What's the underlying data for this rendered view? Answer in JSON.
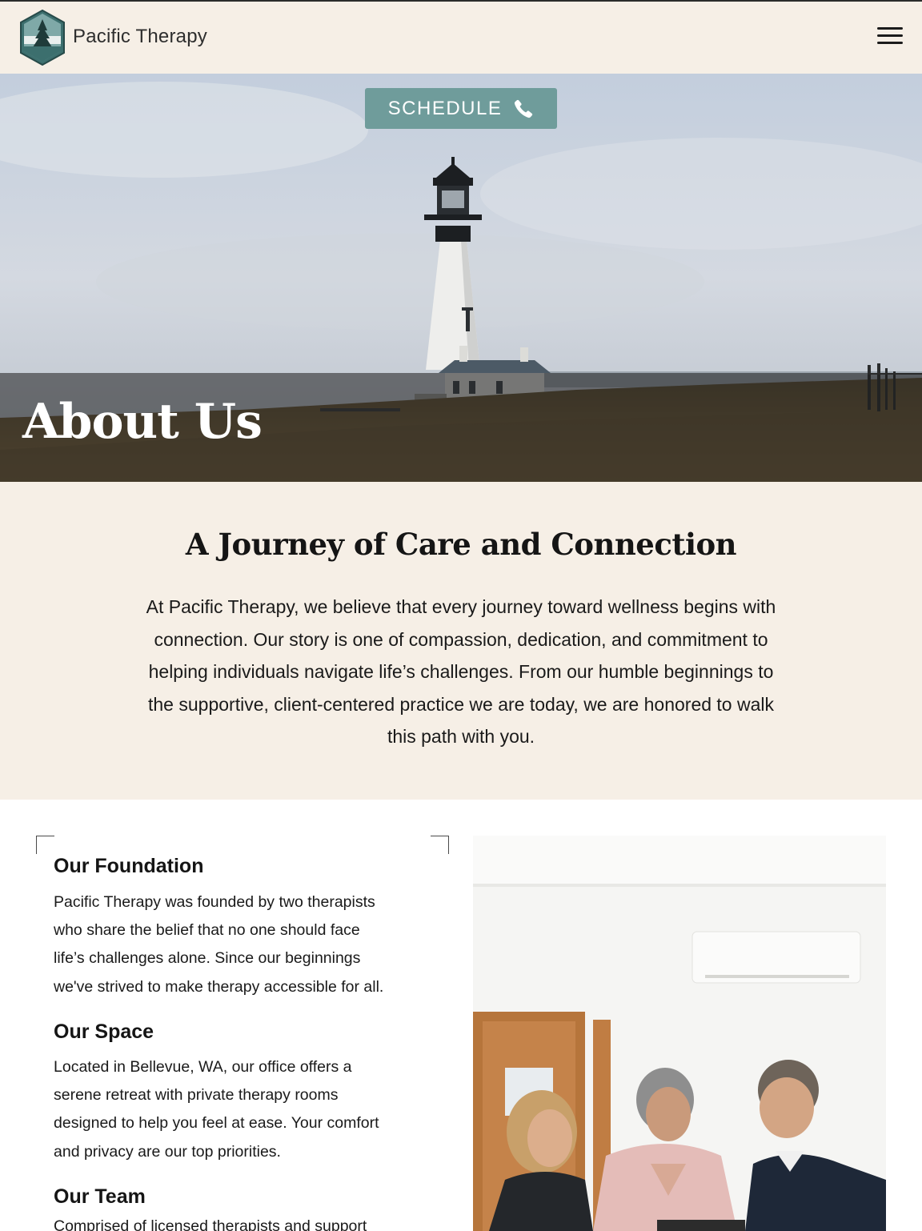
{
  "header": {
    "brand": "Pacific Therapy",
    "logo_icon": "pine-tree-hexagon-logo",
    "menu_icon": "hamburger-menu-icon"
  },
  "hero": {
    "schedule_label": "SCHEDULE",
    "schedule_icon": "phone-icon",
    "title": "About Us",
    "image": "lighthouse-on-coastal-grass"
  },
  "intro": {
    "title": "A Journey of Care and Connection",
    "lines": [
      "At Pacific Therapy, we believe that every journey toward wellness begins with",
      "connection. Our story is one of compassion, dedication, and commitment to",
      "helping individuals navigate life’s challenges. From our humble beginnings to",
      "the supportive, client-centered practice we are today, we are honored to walk",
      "this path with you."
    ]
  },
  "sections": [
    {
      "title": "Our Foundation",
      "lines": [
        "Pacific Therapy was founded by two therapists",
        "who share the belief that no one should face",
        "life’s challenges alone. Since our beginnings",
        "we've strived to make therapy accessible for all."
      ]
    },
    {
      "title": "Our Space",
      "lines": [
        "Located in Bellevue, WA, our office offers a",
        "serene retreat with private therapy rooms",
        "designed to help you feel at ease. Your comfort",
        "and privacy are our top priorities."
      ]
    },
    {
      "title": "Our Team",
      "lines": [
        "Comprised of licensed therapists and support"
      ]
    }
  ],
  "photo": {
    "image": "three-colleagues-looking-at-tablet"
  },
  "colors": {
    "cream": "#f6efe6",
    "teal": "#6f9c9b",
    "text": "#1a1a1a"
  }
}
